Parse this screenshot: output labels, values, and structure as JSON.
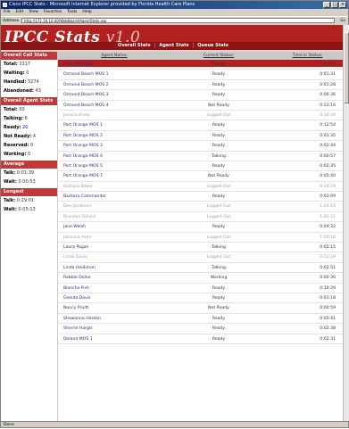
{
  "window": {
    "title": "Cisco IPCC Stats - Microsoft Internet Explorer provided by Florida Health Care Plans",
    "minimize": "_",
    "maximize": "□",
    "close": "×"
  },
  "menu": [
    "File",
    "Edit",
    "View",
    "Favorites",
    "Tools",
    "Help"
  ],
  "address": {
    "label": "Address",
    "url": "http://172.16.10.40/WebBoard/AgentStats.asp",
    "go": "Go"
  },
  "status": "Done",
  "header": {
    "logo": "IPCC Stats",
    "version": "v1.0",
    "nav": [
      "Overall Stats",
      "Agent Stats",
      "Queue Stats"
    ],
    "nav_separator": "|"
  },
  "sidebar": {
    "overall_call": {
      "title": "Overall Call Stats",
      "rows": [
        {
          "label": "Total:",
          "value": "3317",
          "color": "default"
        },
        {
          "label": "Waiting:",
          "value": "0",
          "color": "default"
        },
        {
          "label": "Handled:",
          "value": "3274",
          "color": "default"
        },
        {
          "label": "Abandoned:",
          "value": "43",
          "color": "default"
        }
      ]
    },
    "overall_agent": {
      "title": "Overall Agent Stats",
      "rows": [
        {
          "label": "Total:",
          "value": "30",
          "color": "default"
        },
        {
          "label": "Talking:",
          "value": "6",
          "color": "default"
        },
        {
          "label": "Ready:",
          "value": "20",
          "color": "blue"
        },
        {
          "label": "Not Ready:",
          "value": "4",
          "color": "red"
        },
        {
          "label": "Reserved:",
          "value": "0",
          "color": "default"
        },
        {
          "label": "Working:",
          "value": "0",
          "color": "default"
        }
      ]
    },
    "average": {
      "title": "Average",
      "rows": [
        {
          "label": "Talk:",
          "value": "0:01:39",
          "color": "default"
        },
        {
          "label": "Wait:",
          "value": "0:00:53",
          "color": "default"
        }
      ]
    },
    "longest": {
      "title": "Longest",
      "rows": [
        {
          "label": "Talk:",
          "value": "0:29:01",
          "color": "default"
        },
        {
          "label": "Wait:",
          "value": "0:05:13",
          "color": "default"
        }
      ]
    }
  },
  "table": {
    "headers": [
      "Agent Name:",
      "Current Status:",
      "Time in Status:"
    ],
    "rows": [
      {
        "name": "Dana Minguzzi",
        "status": "Ready",
        "time": "0:00:22",
        "out": false
      },
      {
        "name": "Ormond Beach MOS 1",
        "status": "Ready",
        "time": "0:01:31",
        "out": false
      },
      {
        "name": "Ormond Beach MOS 2",
        "status": "Ready",
        "time": "0:01:28",
        "out": false
      },
      {
        "name": "Ormond Beach MOS 3",
        "status": "Ready",
        "time": "0:00:36",
        "out": false
      },
      {
        "name": "Ormond Beach MOS 4",
        "status": "Not Ready",
        "time": "0:23:16",
        "out": false
      },
      {
        "name": "Jessica Alvey",
        "status": "Logged Out",
        "time": "4:16:44",
        "out": true
      },
      {
        "name": "Port Orange MOS 1",
        "status": "Ready",
        "time": "0:12:54",
        "out": false
      },
      {
        "name": "Port Orange MOS 2",
        "status": "Ready",
        "time": "0:01:35",
        "out": false
      },
      {
        "name": "Port Orange MOS 3",
        "status": "Ready",
        "time": "0:02:44",
        "out": false
      },
      {
        "name": "Port Orange MOS 4",
        "status": "Talking",
        "time": "0:00:57",
        "out": false
      },
      {
        "name": "Port Orange MOS 5",
        "status": "Ready",
        "time": "0:02:35",
        "out": false
      },
      {
        "name": "Port Orange MOS 7",
        "status": "Not Ready",
        "time": "0:05:40",
        "out": false
      },
      {
        "name": "Barbara Baker",
        "status": "Logged Out",
        "time": "0:24:29",
        "out": true
      },
      {
        "name": "Barbara Commander",
        "status": "Ready",
        "time": "0:03:09",
        "out": false
      },
      {
        "name": "Dee Jacobsen",
        "status": "Logged Out",
        "time": "1:24:14",
        "out": true
      },
      {
        "name": "Brandon Dillard",
        "status": "Logged Out",
        "time": "1:42:21",
        "out": true
      },
      {
        "name": "Jane Walsh",
        "status": "Ready",
        "time": "0:04:32",
        "out": false
      },
      {
        "name": "Johanna Ashe",
        "status": "Logged Out",
        "time": "1:59:16",
        "out": true
      },
      {
        "name": "Laura Pagan",
        "status": "Talking",
        "time": "0:02:15",
        "out": false
      },
      {
        "name": "Linda Davis",
        "status": "Logged Out",
        "time": "0:52:19",
        "out": true
      },
      {
        "name": "Linda Heidiman",
        "status": "Talking",
        "time": "0:02:51",
        "out": false
      },
      {
        "name": "Robbie Dollar",
        "status": "Working",
        "time": "0:00:30",
        "out": false
      },
      {
        "name": "Blanche Fish",
        "status": "Ready",
        "time": "0:10:29",
        "out": false
      },
      {
        "name": "Glenda Davis",
        "status": "Ready",
        "time": "0:01:18",
        "out": false
      },
      {
        "name": "Nancy Pruitt",
        "status": "Not Ready",
        "time": "0:00:59",
        "out": false
      },
      {
        "name": "Shawanna Hardan",
        "status": "Ready",
        "time": "0:05:41",
        "out": false
      },
      {
        "name": "Sherrie Hargis",
        "status": "Ready",
        "time": "0:02:38",
        "out": false
      },
      {
        "name": "Deland MOS 1",
        "status": "Ready",
        "time": "0:02:31",
        "out": false
      }
    ]
  }
}
